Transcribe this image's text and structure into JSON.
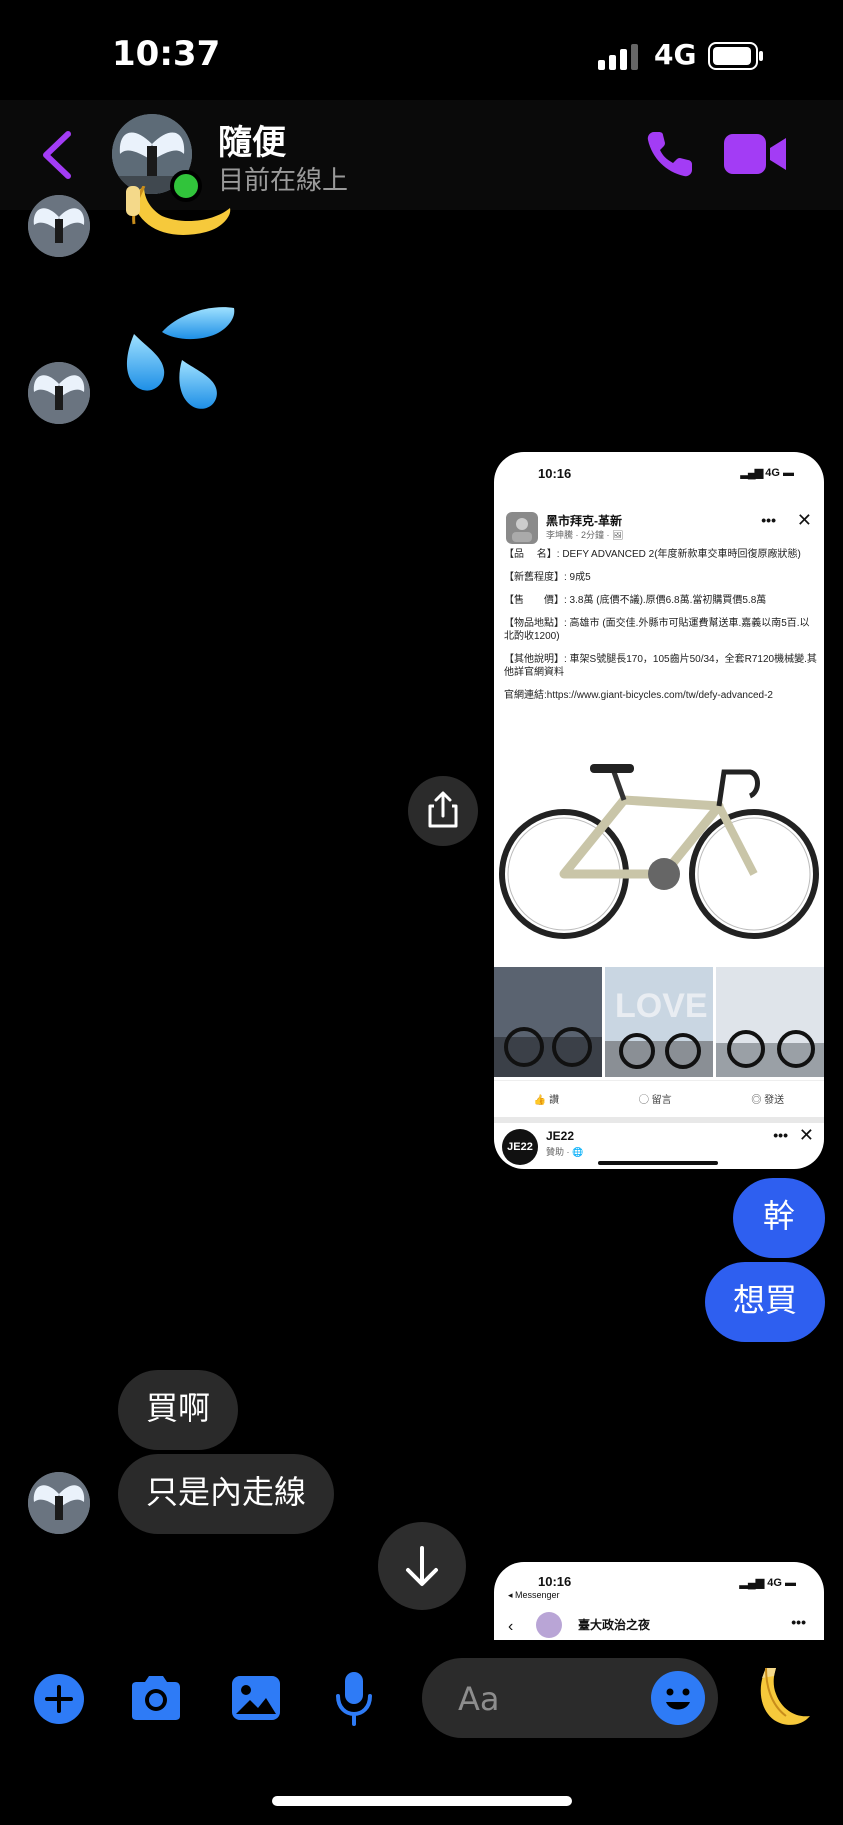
{
  "status_bar": {
    "time": "10:37",
    "network": "4G"
  },
  "header": {
    "contact_name": "隨便",
    "presence": "目前在線上"
  },
  "messages": {
    "out_1": "幹",
    "out_2": "想買",
    "in_1": "買啊",
    "in_2": "只是內走線"
  },
  "shared_card": {
    "time": "10:16",
    "network": "4G",
    "group_name": "黑市拜克-革新",
    "post_meta": "李坤騰 · 2分鐘 · 🖼",
    "lines": [
      "【品　 名】: DEFY ADVANCED 2(年度新款車交車時回復原廠狀態)",
      "【新舊程度】: 9成5",
      "【售　　價】: 3.8萬 (底價不議).原價6.8萬.當初購買價5.8萬",
      "【物品地點】: 高雄市 (面交佳.外縣市可貼運費幫送車.嘉義以南5百.以北酌收1200)",
      "【其他說明】: 車架S號腿長170，105齒片50/34，全套R7120機械變.其他詳官網資料",
      "官網連結:https://www.giant-bicycles.com/tw/defy-advanced-2"
    ],
    "actions": [
      "讚",
      "留言",
      "發送"
    ],
    "ad_name": "JE22",
    "ad_meta": "贊助 · 🌐"
  },
  "second_card": {
    "time": "10:16",
    "network": "4G",
    "back_app": "◂ Messenger",
    "title": "臺大政治之夜"
  },
  "composer": {
    "placeholder": "Aa"
  },
  "colors": {
    "accent": "#a33cf5",
    "bubble_out": "#2e5ff0",
    "bubble_in": "#2a2a2a",
    "tool_blue": "#2e7bf6"
  }
}
